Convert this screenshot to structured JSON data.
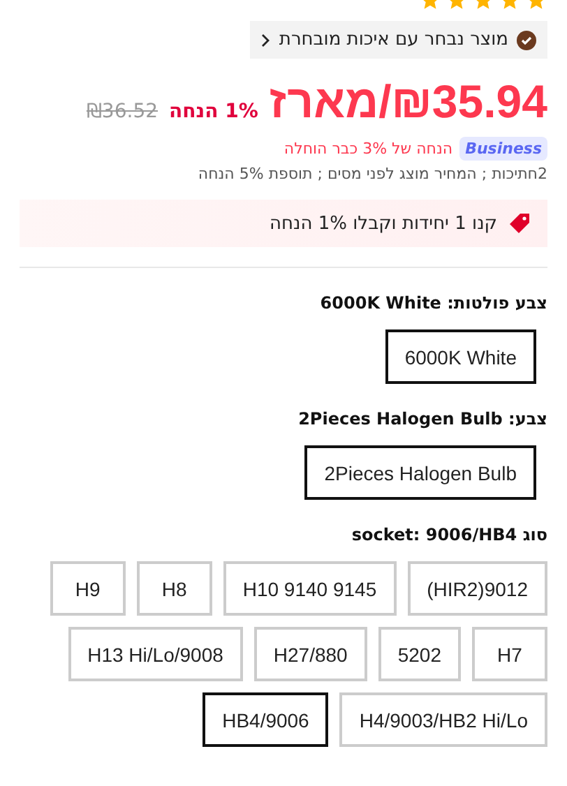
{
  "rating": {
    "stars": 5
  },
  "quality_badge": {
    "text": "מוצר נבחר עם איכות מובחרת"
  },
  "price": {
    "current": "₪35.94/מארז",
    "discount": "1% הנחה",
    "original": "₪36.52"
  },
  "business": {
    "badge": "Business",
    "text": "הנחה של 3% כבר הוחלה"
  },
  "price_note": "2חתיכות ; המחיר מוצג לפני מסים ; תוספת 5% הנחה",
  "promo": {
    "text": "קנו 1 יחידות וקבלו 1% הנחה"
  },
  "option_groups": [
    {
      "title": "צבע פולטות: 6000K White",
      "options": [
        {
          "label": "6000K White",
          "selected": true
        }
      ]
    },
    {
      "title": "צבע: 2Pieces Halogen Bulb",
      "options": [
        {
          "label": "2Pieces Halogen Bulb",
          "selected": true
        }
      ]
    },
    {
      "title": "סוג socket: 9006/HB4",
      "options": [
        {
          "label": "(HIR2)9012",
          "selected": false
        },
        {
          "label": "H10 9140 9145",
          "selected": false
        },
        {
          "label": "H8",
          "selected": false
        },
        {
          "label": "H9",
          "selected": false
        },
        {
          "label": "H7",
          "selected": false
        },
        {
          "label": "5202",
          "selected": false
        },
        {
          "label": "H27/880",
          "selected": false
        },
        {
          "label": "H13 Hi/Lo/9008",
          "selected": false
        },
        {
          "label": "H4/9003/HB2 Hi/Lo",
          "selected": false
        },
        {
          "label": "HB4/9006",
          "selected": true
        }
      ]
    }
  ]
}
